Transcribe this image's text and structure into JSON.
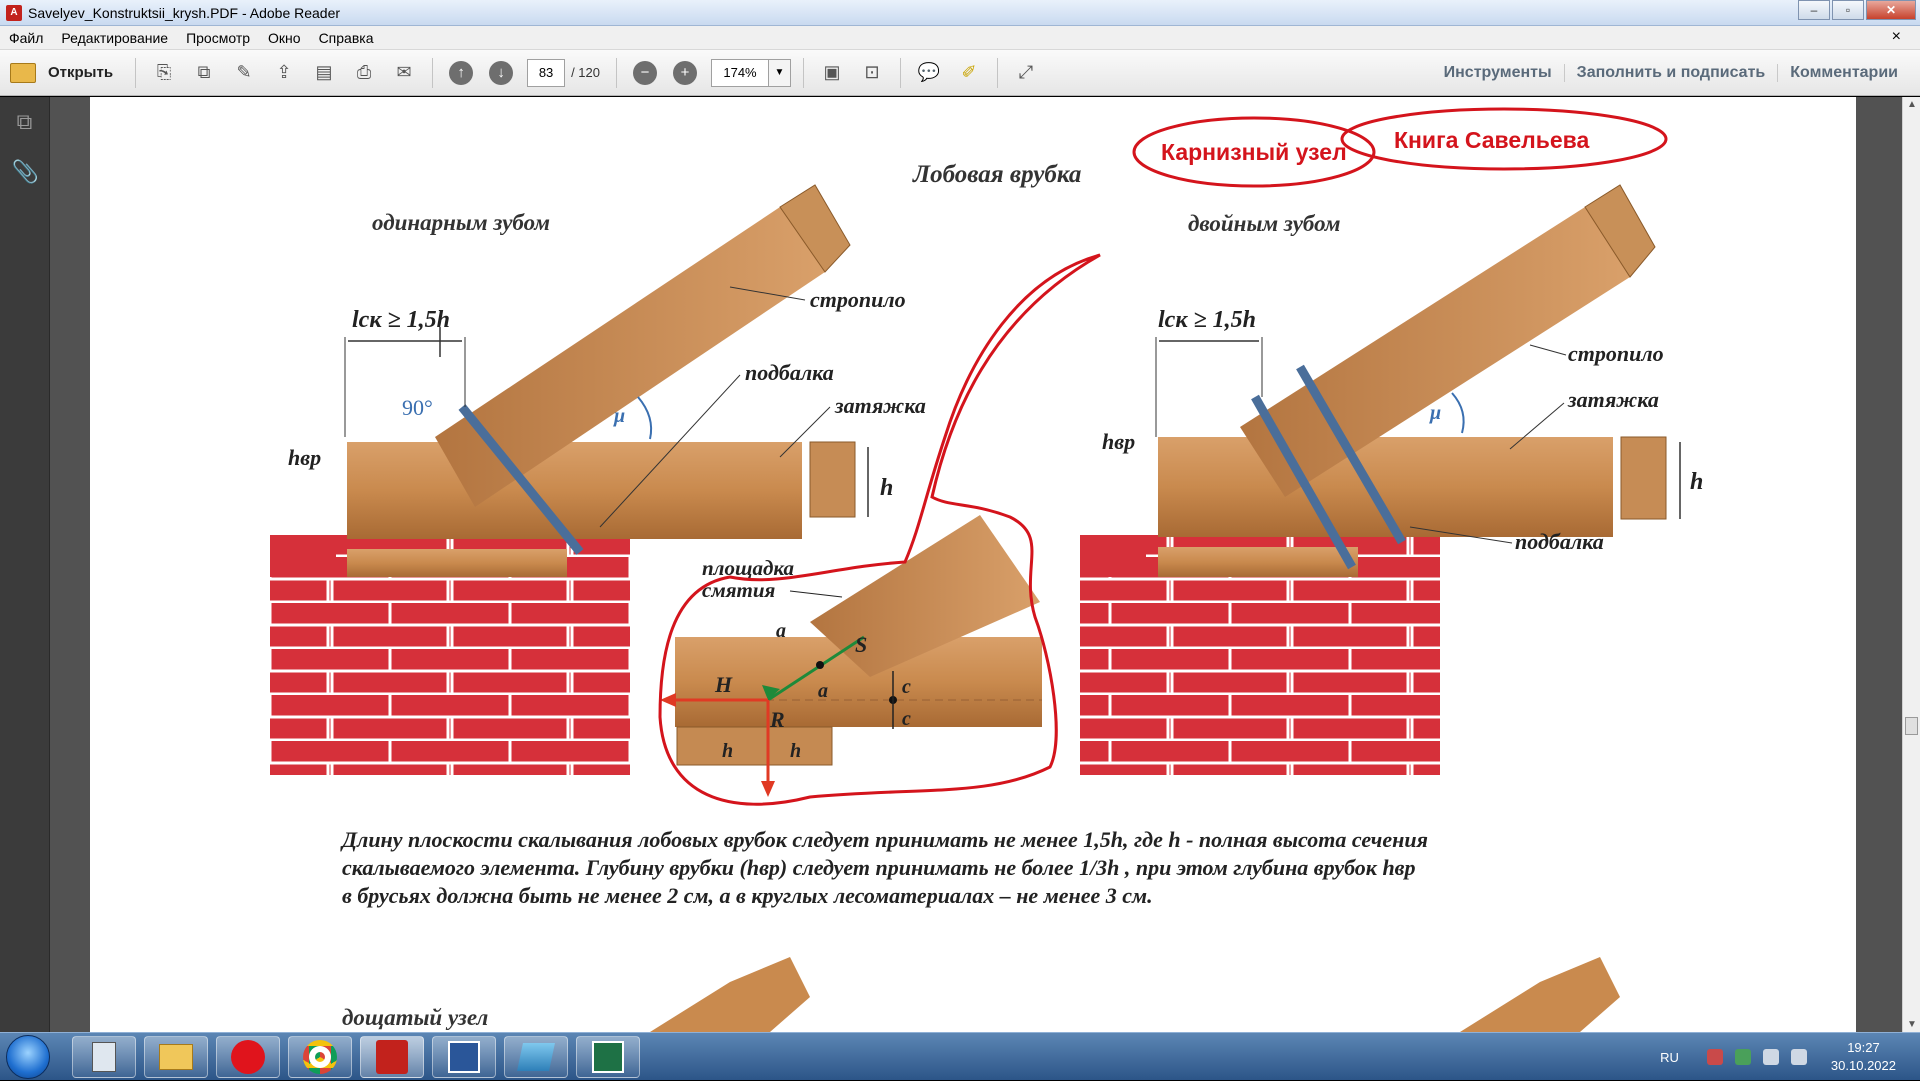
{
  "window": {
    "title": "Savelyev_Konstruktsii_krysh.PDF - Adobe Reader",
    "minimize": "–",
    "maximize": "▫",
    "close": "✕"
  },
  "menu": {
    "items": [
      "Файл",
      "Редактирование",
      "Просмотр",
      "Окно",
      "Справка"
    ],
    "close": "×"
  },
  "toolbar": {
    "open_label": "Открыть",
    "page_current": "83",
    "page_total": "/ 120",
    "zoom": "174%",
    "links": [
      "Инструменты",
      "Заполнить и подписать",
      "Комментарии"
    ]
  },
  "document": {
    "heading": "Лобовая врубка",
    "left_caption": "одинарным зубом",
    "right_caption": "двойным зубом",
    "labels": {
      "rafter": "стропило",
      "subbeam": "подбалка",
      "tie": "затяжка",
      "lck": "lск ≥ 1,5h",
      "angle90": "90°",
      "mu": "μ",
      "hvr": "hвр",
      "h": "h",
      "crush_area_1": "площадка",
      "crush_area_2": "смятия",
      "a": "a",
      "S": "S",
      "H": "H",
      "R": "R",
      "c": "c"
    },
    "annotation_1": "Карнизный узел",
    "annotation_2": "Книга Савельева",
    "paragraph": [
      "Длину плоскости скалывания лобовых врубок следует принимать не менее 1,5h, где h - полная высота сечения",
      "скалываемого элемента. Глубину врубки (hвр) следует принимать не более 1/3h , при этом глубина врубок hвр",
      "в брусьях должна быть не менее 2 см, а в круглых лесоматериалах –  не менее 3 см."
    ],
    "next_section": "дощатый узел"
  },
  "taskbar": {
    "language": "RU",
    "time": "19:27",
    "date": "30.10.2022"
  },
  "colors": {
    "brick": "#d6303a",
    "wood": "#c98a4e",
    "annotation": "#d4141c",
    "bolt": "#4a6e9a"
  }
}
